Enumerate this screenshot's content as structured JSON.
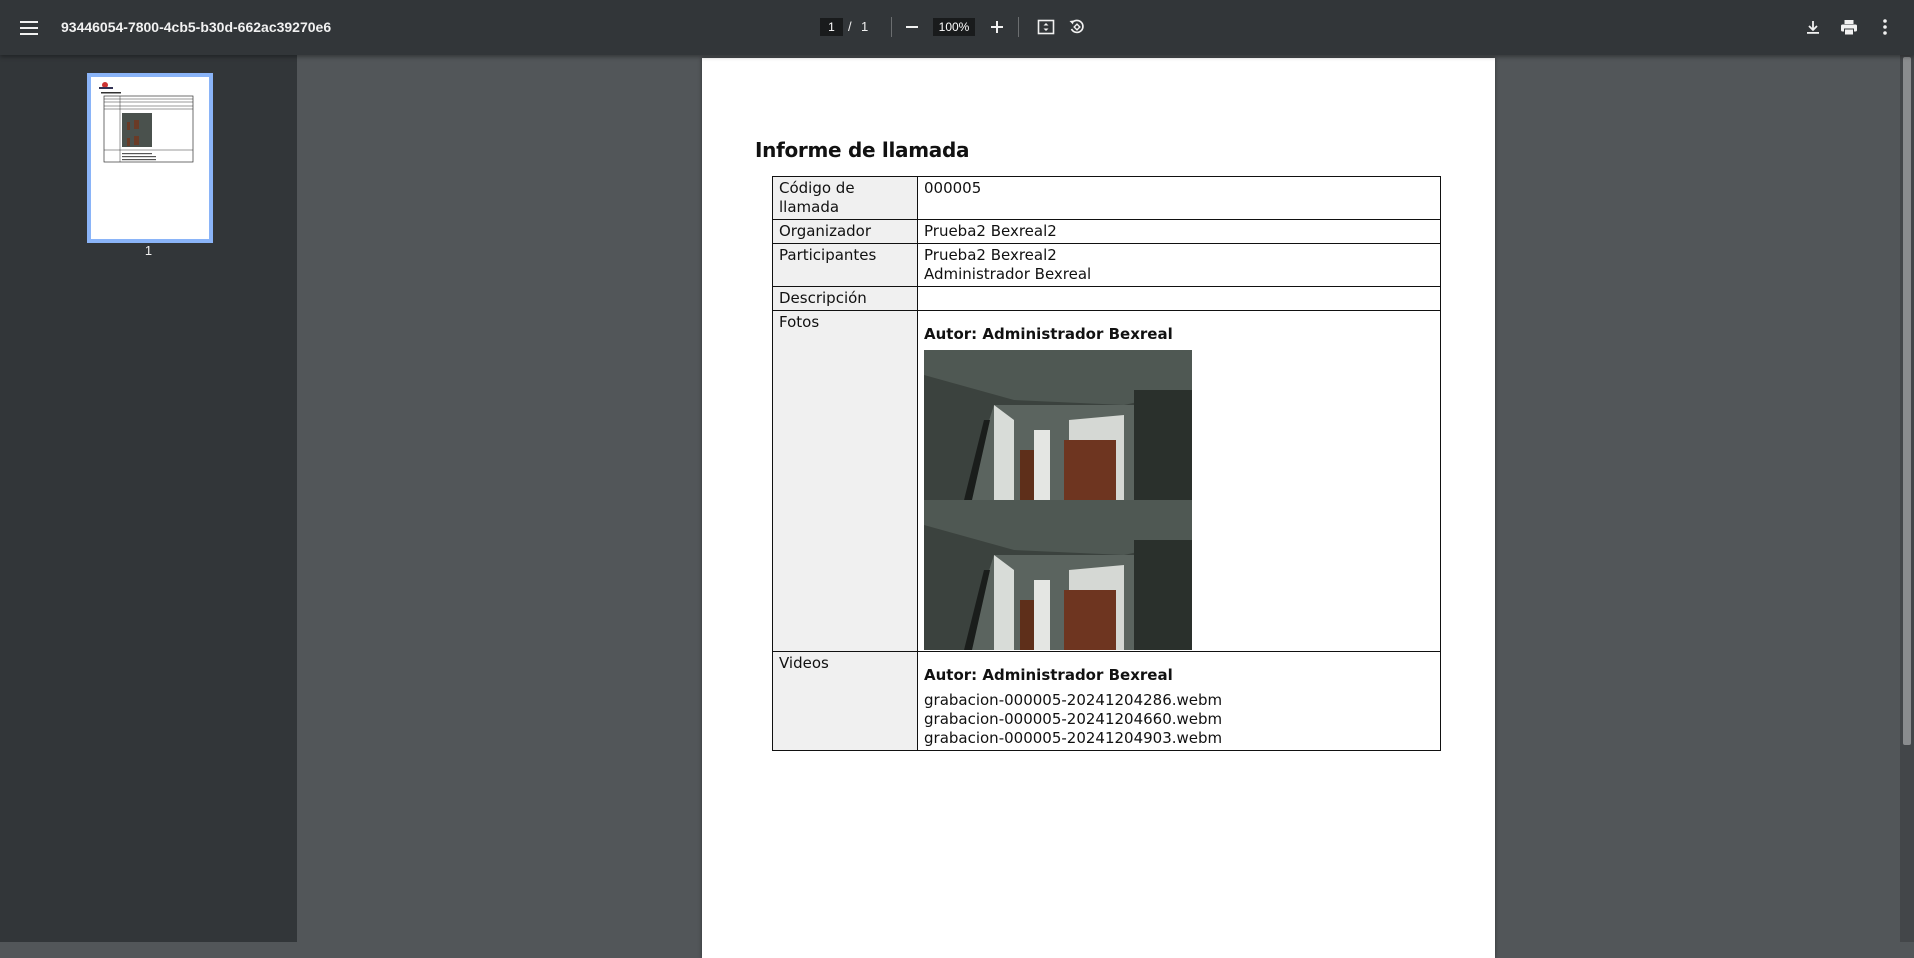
{
  "toolbar": {
    "title": "93446054-7800-4cb5-b30d-662ac39270e6",
    "page_current": "1",
    "page_sep": "/",
    "page_total": "1",
    "zoom": "100%"
  },
  "sidebar": {
    "thumbnail_page": "1"
  },
  "document": {
    "heading": "Informe de llamada",
    "rows": {
      "code": {
        "label": "Código de llamada",
        "value": "000005"
      },
      "organizer": {
        "label": "Organizador",
        "value": "Prueba2 Bexreal2"
      },
      "participants": {
        "label": "Participantes",
        "values": [
          "Prueba2 Bexreal2",
          "Administrador Bexreal"
        ]
      },
      "description": {
        "label": "Descripción",
        "value": ""
      },
      "photos": {
        "label": "Fotos",
        "author": "Autor: Administrador Bexreal"
      },
      "videos": {
        "label": "Videos",
        "author": "Autor: Administrador Bexreal",
        "files": [
          "grabacion-000005-20241204286.webm",
          "grabacion-000005-20241204660.webm",
          "grabacion-000005-20241204903.webm"
        ]
      }
    }
  },
  "colors": {
    "toolbar_bg": "#323639",
    "viewer_bg": "#525659",
    "thumb_border": "#8ab4f8"
  }
}
